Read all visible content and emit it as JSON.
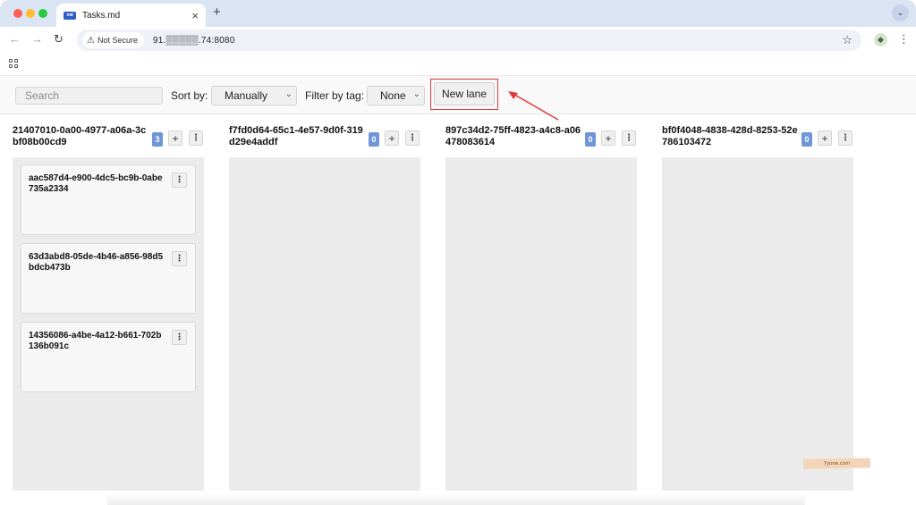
{
  "browser": {
    "tab_title": "Tasks.md",
    "tab_favicon_text": "md",
    "security_label": "Not Secure",
    "url": "91.▒▒▒▒▒.74:8080"
  },
  "toolbar": {
    "search_placeholder": "Search",
    "sort_label": "Sort by:",
    "sort_value": "Manually",
    "filter_label": "Filter by tag:",
    "filter_value": "None",
    "new_lane_label": "New lane"
  },
  "lanes": [
    {
      "title": "21407010-0a00-4977-a06a-3cbf08b00cd9",
      "count": "3",
      "cards": [
        {
          "title": "aac587d4-e900-4dc5-bc9b-0abe735a2334"
        },
        {
          "title": "63d3abd8-05de-4b46-a856-98d5bdcb473b"
        },
        {
          "title": "14356086-a4be-4a12-b661-702b136b091c"
        }
      ]
    },
    {
      "title": "f7fd0d64-65c1-4e57-9d0f-319d29e4addf",
      "count": "0",
      "cards": []
    },
    {
      "title": "897c34d2-75ff-4823-a4c8-a06478083614",
      "count": "0",
      "cards": []
    },
    {
      "title": "bf0f4048-4838-428d-8253-52e786103472",
      "count": "0",
      "cards": []
    }
  ],
  "watermark_text": "Tyone.com",
  "colors": {
    "count_badge": "#6f96d8",
    "highlight": "#e03b3b",
    "lane_background": "#ebebeb"
  }
}
